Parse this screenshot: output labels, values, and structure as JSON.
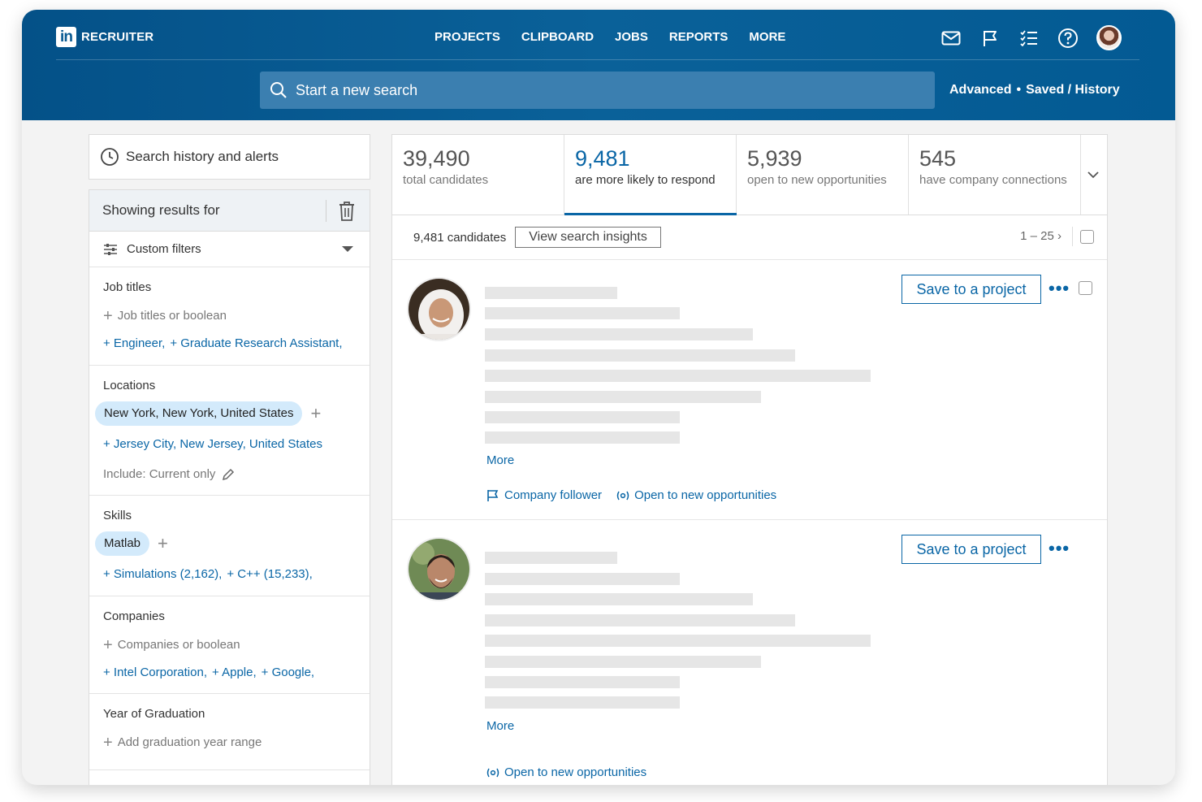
{
  "header": {
    "logo_mark": "in",
    "product": "RECRUITER",
    "nav": [
      "PROJECTS",
      "CLIPBOARD",
      "JOBS",
      "REPORTS",
      "MORE"
    ],
    "icons": [
      "mail-icon",
      "flag-icon",
      "checklist-icon",
      "help-icon",
      "profile-avatar"
    ],
    "search_placeholder": "Start a new search",
    "advanced": "Advanced",
    "bullet": "•",
    "saved_history": "Saved / History"
  },
  "sidebar": {
    "history": "Search history and alerts",
    "showing": "Showing results for",
    "custom_filters": "Custom filters",
    "job_titles": {
      "title": "Job titles",
      "placeholder": "Job titles or boolean",
      "suggestions": [
        "+ Engineer,",
        "+ Graduate Research Assistant,"
      ]
    },
    "locations": {
      "title": "Locations",
      "selected": "New York, New York, United States",
      "suggestion": "+ Jersey City, New Jersey, United States",
      "include": "Include: Current only"
    },
    "skills": {
      "title": "Skills",
      "selected": "Matlab",
      "suggestions": [
        "+ Simulations (2,162),",
        "+ C++ (15,233),"
      ]
    },
    "companies": {
      "title": "Companies",
      "placeholder": "Companies or boolean",
      "suggestions": [
        "+ Intel Corporation,",
        "+ Apple,",
        "+ Google,"
      ]
    },
    "graduation": {
      "title": "Year of Graduation",
      "placeholder": "Add graduation year range"
    }
  },
  "stats": [
    {
      "value": "39,490",
      "label": "total candidates"
    },
    {
      "value": "9,481",
      "label": "are more likely to respond"
    },
    {
      "value": "5,939",
      "label": "open to new opportunities"
    },
    {
      "value": "545",
      "label": "have company connections"
    }
  ],
  "results": {
    "count": "9,481 candidates",
    "insights_button": "View search insights",
    "pager": "1 – 25"
  },
  "candidates": [
    {
      "save": "Save to a project",
      "more": "More",
      "dots": "•••",
      "tags": [
        "Company follower",
        "Open to new opportunities"
      ]
    },
    {
      "save": "Save to a project",
      "more": "More",
      "dots": "•••",
      "tags": [
        "Open to new opportunities"
      ]
    }
  ],
  "colors": {
    "brand": "#0a66a6",
    "header": "#035a93",
    "pill": "#d3eafb"
  }
}
